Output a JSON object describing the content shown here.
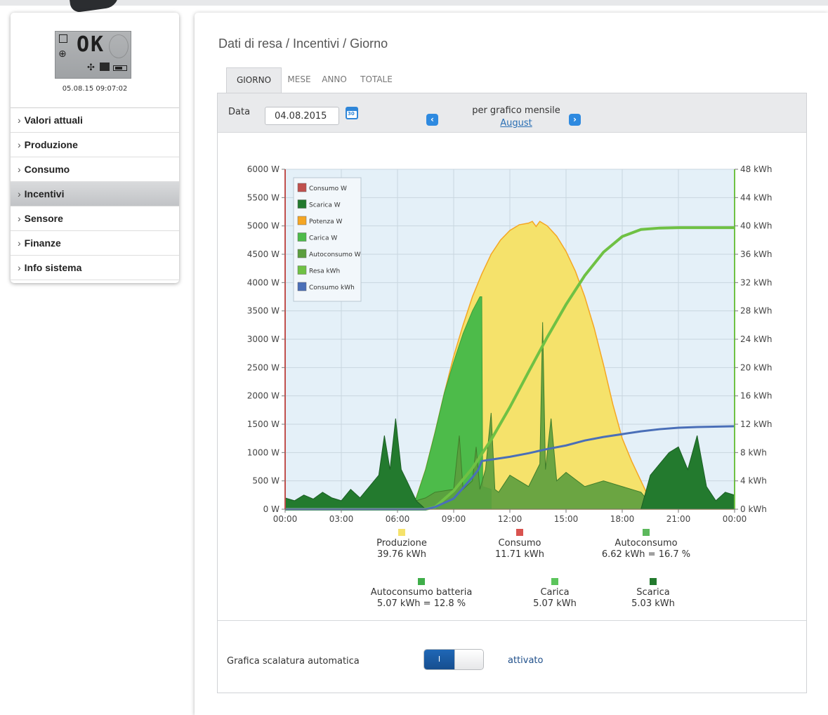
{
  "device": {
    "display": "OK",
    "timestamp": "05.08.15 09:07:02"
  },
  "sidebar": {
    "items": [
      {
        "label": "Valori attuali",
        "active": false
      },
      {
        "label": "Produzione",
        "active": false
      },
      {
        "label": "Consumo",
        "active": false
      },
      {
        "label": "Incentivi",
        "active": true
      },
      {
        "label": "Sensore",
        "active": false
      },
      {
        "label": "Finanze",
        "active": false
      },
      {
        "label": "Info sistema",
        "active": false
      }
    ],
    "chevron": "›"
  },
  "page": {
    "title": "Dati di resa / Incentivi / Giorno"
  },
  "tabs": [
    {
      "label": "GIORNO",
      "active": true
    },
    {
      "label": "MESE",
      "active": false
    },
    {
      "label": "ANNO",
      "active": false
    },
    {
      "label": "TOTALE",
      "active": false
    }
  ],
  "filter": {
    "date_label": "Data",
    "date_value": "04.08.2015",
    "calendar_icon": "calendar-icon",
    "prev_icon": "chevron-left-icon",
    "next_icon": "chevron-right-icon",
    "monthly_text": "per grafico mensile",
    "month_link": "August"
  },
  "colors": {
    "consumo": "#c0504d",
    "scarica": "#237a2e",
    "potenza": "#f5a623",
    "carica": "#4dbb4a",
    "autoconsumo": "#5c9e3e",
    "resa": "#6fc144",
    "consumo_kwh": "#4a6fb8",
    "produzione_fill": "#f5e26b",
    "plot_bg": "#e4f0f8"
  },
  "chart_data": {
    "type": "area",
    "x_ticks": [
      "00:00",
      "03:00",
      "06:00",
      "09:00",
      "12:00",
      "15:00",
      "18:00",
      "21:00",
      "00:00"
    ],
    "y_left_ticks": [
      "0 W",
      "500 W",
      "1000 W",
      "1500 W",
      "2000 W",
      "2500 W",
      "3000 W",
      "3500 W",
      "4000 W",
      "4500 W",
      "5000 W",
      "5500 W",
      "6000 W"
    ],
    "y_right_ticks": [
      "0 kWh",
      "4 kWh",
      "8 kWh",
      "12 kWh",
      "16 kWh",
      "20 kWh",
      "24 kWh",
      "28 kWh",
      "32 kWh",
      "36 kWh",
      "40 kWh",
      "44 kWh",
      "48 kWh"
    ],
    "x_range_hours": [
      0,
      24
    ],
    "y_left_range": [
      0,
      6000
    ],
    "y_right_range": [
      0,
      48
    ],
    "grid": true,
    "legend_position": "top-left",
    "legend": [
      "Consumo W",
      "Scarica W",
      "Potenza W",
      "Carica W",
      "Autoconsumo W",
      "Resa kWh",
      "Consumo kWh"
    ],
    "series": [
      {
        "name": "Potenza W",
        "axis": "left",
        "x": [
          0,
          6.5,
          7,
          7.5,
          8,
          8.5,
          9,
          9.5,
          10,
          10.5,
          11,
          11.5,
          12,
          12.5,
          13,
          13.2,
          13.4,
          13.6,
          14,
          14.5,
          15,
          15.5,
          16,
          16.5,
          17,
          17.5,
          18,
          18.5,
          19,
          19.5,
          20,
          24
        ],
        "values": [
          0,
          0,
          200,
          700,
          1350,
          2050,
          2700,
          3250,
          3750,
          4150,
          4500,
          4750,
          4920,
          5020,
          5050,
          5080,
          4990,
          5080,
          5000,
          4820,
          4550,
          4200,
          3750,
          3200,
          2550,
          1850,
          1250,
          850,
          500,
          150,
          0,
          0
        ]
      },
      {
        "name": "Carica W",
        "axis": "left",
        "x": [
          6.5,
          7,
          7.5,
          8,
          8.5,
          9,
          9.5,
          10,
          10.4,
          10.5,
          10.55,
          11
        ],
        "values": [
          0,
          200,
          700,
          1350,
          2050,
          2600,
          3100,
          3500,
          3750,
          3750,
          400,
          350
        ]
      },
      {
        "name": "Autoconsumo W",
        "axis": "left",
        "x": [
          0,
          3,
          6,
          7,
          7.5,
          8,
          9,
          9.3,
          9.5,
          10,
          10.2,
          10.4,
          10.7,
          11,
          11.2,
          11.4,
          12,
          13,
          13.6,
          13.75,
          13.9,
          14.2,
          14.5,
          15,
          16,
          17,
          18,
          19,
          19.5,
          20,
          24
        ],
        "values": [
          50,
          80,
          100,
          150,
          200,
          300,
          350,
          1300,
          350,
          500,
          1100,
          350,
          700,
          1700,
          350,
          300,
          600,
          400,
          800,
          3300,
          700,
          1600,
          500,
          650,
          400,
          500,
          400,
          300,
          100,
          0,
          0
        ]
      },
      {
        "name": "Scarica W",
        "axis": "left",
        "x": [
          0,
          0.5,
          1,
          1.5,
          2,
          2.5,
          3,
          3.5,
          4,
          4.5,
          5,
          5.3,
          5.6,
          5.9,
          6.2,
          6.5,
          7,
          7.5,
          19,
          19.5,
          20,
          20.5,
          21,
          21.5,
          22,
          22.5,
          23,
          23.5,
          24
        ],
        "values": [
          200,
          150,
          250,
          180,
          300,
          200,
          150,
          350,
          200,
          400,
          600,
          1300,
          700,
          1600,
          700,
          500,
          150,
          0,
          0,
          600,
          800,
          1000,
          1100,
          700,
          1300,
          400,
          150,
          300,
          250
        ]
      },
      {
        "name": "Resa kWh",
        "axis": "right",
        "x": [
          0,
          7.5,
          8,
          9,
          10,
          11,
          12,
          13,
          14,
          15,
          16,
          17,
          18,
          19,
          20,
          21,
          24
        ],
        "values": [
          0,
          0,
          0.3,
          2.6,
          5.8,
          9.8,
          14.4,
          19.4,
          24.3,
          28.9,
          33.0,
          36.3,
          38.5,
          39.5,
          39.7,
          39.76,
          39.76
        ]
      },
      {
        "name": "Consumo kWh",
        "axis": "right",
        "x": [
          0,
          7.5,
          8,
          9,
          10,
          10.3,
          10.5,
          11,
          12,
          13,
          14,
          15,
          16,
          17,
          18,
          19,
          20,
          21,
          22,
          24
        ],
        "values": [
          0,
          0,
          0.3,
          1.5,
          4.5,
          5.5,
          6.8,
          7.0,
          7.4,
          7.9,
          8.5,
          9.0,
          9.7,
          10.2,
          10.6,
          11.0,
          11.3,
          11.5,
          11.6,
          11.71
        ]
      }
    ]
  },
  "summary": [
    {
      "label": "Produzione",
      "value": "39.76 kWh",
      "color": "#f5e26b"
    },
    {
      "label": "Consumo",
      "value": "11.71 kWh",
      "color": "#d9534f"
    },
    {
      "label": "Autoconsumo",
      "value": "6.62 kWh = 16.7 %",
      "color": "#5cb85c"
    },
    {
      "label": "Autoconsumo batteria",
      "value": "5.07 kWh = 12.8 %",
      "color": "#3fae49"
    },
    {
      "label": "Carica",
      "value": "5.07 kWh",
      "color": "#5cc55c"
    },
    {
      "label": "Scarica",
      "value": "5.03 kWh",
      "color": "#237a2e"
    }
  ],
  "autoscale": {
    "label": "Grafica scalatura automatica",
    "toggle_on_text": "I",
    "state": "attivato"
  }
}
